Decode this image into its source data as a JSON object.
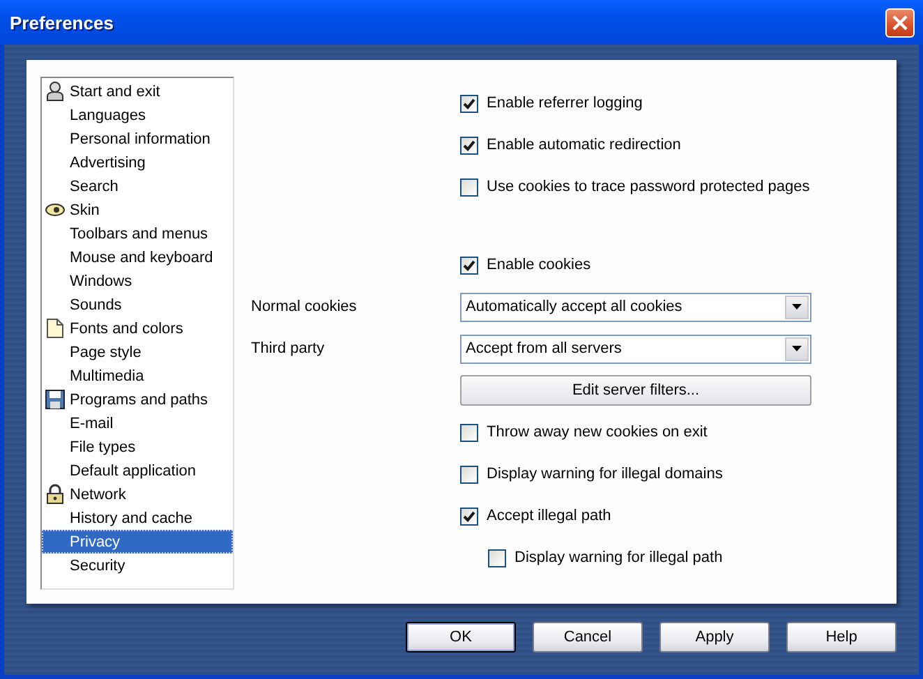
{
  "window": {
    "title": "Preferences",
    "close": "×"
  },
  "sidebar": {
    "items": [
      {
        "label": "Start and exit",
        "kind": "section",
        "selected": false
      },
      {
        "label": "Languages",
        "kind": "page",
        "selected": false
      },
      {
        "label": "Personal information",
        "kind": "page",
        "selected": false
      },
      {
        "label": "Advertising",
        "kind": "page",
        "selected": false
      },
      {
        "label": "Search",
        "kind": "page",
        "selected": false
      },
      {
        "label": "Skin",
        "kind": "section",
        "selected": false
      },
      {
        "label": "Toolbars and menus",
        "kind": "page",
        "selected": false
      },
      {
        "label": "Mouse and keyboard",
        "kind": "page",
        "selected": false
      },
      {
        "label": "Windows",
        "kind": "page",
        "selected": false
      },
      {
        "label": "Sounds",
        "kind": "page",
        "selected": false
      },
      {
        "label": "Fonts and colors",
        "kind": "section",
        "selected": false
      },
      {
        "label": "Page style",
        "kind": "page",
        "selected": false
      },
      {
        "label": "Multimedia",
        "kind": "page",
        "selected": false
      },
      {
        "label": "Programs and paths",
        "kind": "section",
        "selected": false
      },
      {
        "label": "E-mail",
        "kind": "page",
        "selected": false
      },
      {
        "label": "File types",
        "kind": "page",
        "selected": false
      },
      {
        "label": "Default application",
        "kind": "page",
        "selected": false
      },
      {
        "label": "Network",
        "kind": "section",
        "selected": false
      },
      {
        "label": "History and cache",
        "kind": "page",
        "selected": false
      },
      {
        "label": "Privacy",
        "kind": "page",
        "selected": true
      },
      {
        "label": "Security",
        "kind": "page",
        "selected": false
      }
    ]
  },
  "groups": [
    {
      "options": [
        {
          "kind": "checkbox",
          "label": "Enable referrer logging",
          "checked": true
        },
        {
          "kind": "checkbox",
          "label": "Enable automatic redirection",
          "checked": true
        },
        {
          "kind": "checkbox",
          "label": "Use cookies to trace password protected pages",
          "checked": false
        }
      ]
    },
    {
      "options": [
        {
          "kind": "checkbox",
          "label": "Enable cookies",
          "checked": true
        },
        {
          "kind": "select",
          "label": "Normal cookies",
          "value": "Automatically accept all cookies"
        },
        {
          "kind": "select",
          "label": "Third party",
          "value": "Accept from all servers"
        },
        {
          "kind": "button",
          "label": "Edit server filters..."
        },
        {
          "kind": "checkbox",
          "label": "Throw away new cookies on exit",
          "checked": false
        },
        {
          "kind": "checkbox",
          "label": "Display warning for illegal domains",
          "checked": false
        },
        {
          "kind": "checkbox",
          "label": "Accept illegal path",
          "checked": true
        },
        {
          "kind": "sub_checkbox",
          "label": "Display warning for illegal path",
          "checked": false
        }
      ]
    }
  ],
  "buttons": [
    {
      "label": "OK",
      "default": true
    },
    {
      "label": "Cancel",
      "default": false
    },
    {
      "label": "Apply",
      "default": false
    },
    {
      "label": "Help",
      "default": false
    }
  ]
}
